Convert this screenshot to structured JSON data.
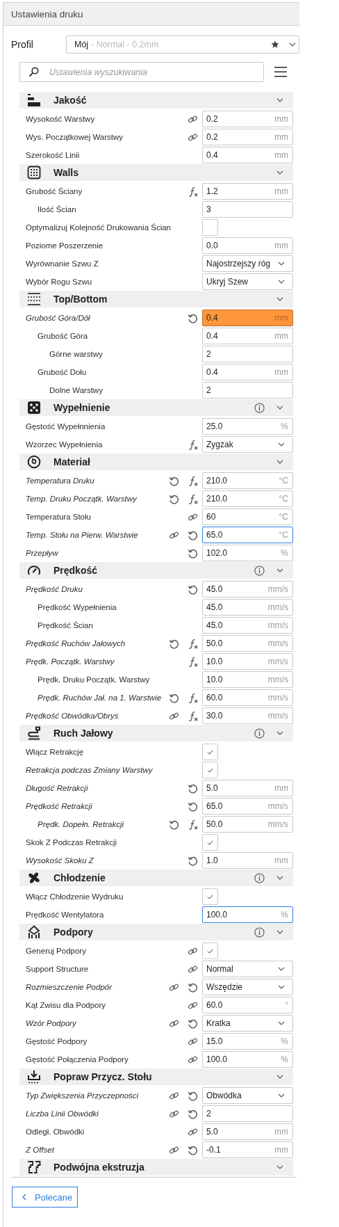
{
  "window": {
    "title": "Ustawienia druku"
  },
  "profile": {
    "label": "Profil",
    "name": "Mój",
    "detail": "- Normal - 0.2mm"
  },
  "search": {
    "placeholder": "Ustawienia wyszukiwania"
  },
  "sections": [
    {
      "kind": "quality",
      "title": "Jakość",
      "info": false,
      "rows": [
        {
          "label": "Wysokość Warstwy",
          "modified": false,
          "linked": true,
          "resettable": false,
          "formula": false,
          "kind": "number",
          "value": "0.2",
          "unit": "mm"
        },
        {
          "label": "Wys. Początkowej Warstwy",
          "modified": false,
          "linked": true,
          "resettable": false,
          "formula": false,
          "kind": "number",
          "value": "0.2",
          "unit": "mm"
        },
        {
          "label": "Szerokość Linii",
          "modified": false,
          "linked": false,
          "resettable": false,
          "formula": false,
          "kind": "number",
          "value": "0.4",
          "unit": "mm"
        }
      ]
    },
    {
      "kind": "walls",
      "title": "Walls",
      "info": false,
      "rows": [
        {
          "label": "Grubość Ściany",
          "modified": false,
          "linked": false,
          "resettable": false,
          "formula": true,
          "kind": "number",
          "value": "1.2",
          "unit": "mm",
          "children": [
            {
              "label": "Ilość Ścian",
              "modified": false,
              "linked": false,
              "resettable": false,
              "formula": false,
              "kind": "number",
              "value": "3"
            }
          ]
        },
        {
          "label": "Optymalizuj Kolejność Drukowania Ścian",
          "modified": false,
          "linked": false,
          "resettable": false,
          "formula": false,
          "kind": "checkbox",
          "checked": false
        },
        {
          "label": "Poziome Poszerzenie",
          "modified": false,
          "linked": false,
          "resettable": false,
          "formula": false,
          "kind": "number",
          "value": "0.0",
          "unit": "mm"
        },
        {
          "label": "Wyrównanie Szwu Z",
          "modified": false,
          "linked": false,
          "resettable": false,
          "formula": false,
          "kind": "dropdown",
          "value": "Najostrzejszy róg"
        },
        {
          "label": "Wybór Rogu Szwu",
          "modified": false,
          "linked": false,
          "resettable": false,
          "formula": false,
          "kind": "dropdown",
          "value": "Ukryj Szew"
        }
      ]
    },
    {
      "kind": "topbottom",
      "title": "Top/Bottom",
      "info": false,
      "rows": [
        {
          "label": "Grubość Góra/Dół",
          "modified": true,
          "linked": false,
          "resettable": true,
          "formula": false,
          "kind": "number",
          "value": "0.4",
          "unit": "mm",
          "warning": true,
          "children": [
            {
              "label": "Grubość Góra",
              "modified": false,
              "linked": false,
              "resettable": false,
              "formula": false,
              "kind": "number",
              "value": "0.4",
              "unit": "mm",
              "children": [
                {
                  "label": "Górne warstwy",
                  "modified": false,
                  "linked": false,
                  "resettable": false,
                  "formula": false,
                  "kind": "number",
                  "value": "2"
                }
              ]
            },
            {
              "label": "Grubość Dołu",
              "modified": false,
              "linked": false,
              "resettable": false,
              "formula": false,
              "kind": "number",
              "value": "0.4",
              "unit": "mm",
              "children": [
                {
                  "label": "Dolne Warstwy",
                  "modified": false,
                  "linked": false,
                  "resettable": false,
                  "formula": false,
                  "kind": "number",
                  "value": "2"
                }
              ]
            }
          ]
        }
      ]
    },
    {
      "kind": "infill",
      "title": "Wypełnienie",
      "info": true,
      "rows": [
        {
          "label": "Gęstość Wypełnnienia",
          "modified": false,
          "linked": false,
          "resettable": false,
          "formula": false,
          "kind": "number",
          "value": "25.0",
          "unit": "%"
        },
        {
          "label": "Wzorzec Wypełnienia",
          "modified": false,
          "linked": false,
          "resettable": false,
          "formula": true,
          "kind": "dropdown",
          "value": "Zygzak"
        }
      ]
    },
    {
      "kind": "material",
      "title": "Materiał",
      "info": false,
      "rows": [
        {
          "label": "Temperatura Druku",
          "modified": true,
          "linked": false,
          "resettable": true,
          "formula": true,
          "kind": "number",
          "value": "210.0",
          "unit": "°C"
        },
        {
          "label": "Temp. Druku Początk. Warstwy",
          "modified": true,
          "linked": false,
          "resettable": true,
          "formula": true,
          "kind": "number",
          "value": "210.0",
          "unit": "°C"
        },
        {
          "label": "Temperatura Stołu",
          "modified": false,
          "linked": true,
          "resettable": false,
          "formula": false,
          "kind": "number",
          "value": "60",
          "unit": "°C"
        },
        {
          "label": "Temp. Stołu na Pierw. Warstwie",
          "modified": true,
          "linked": true,
          "resettable": true,
          "formula": false,
          "kind": "number",
          "value": "65.0",
          "unit": "°C",
          "focused": true
        },
        {
          "label": "Przepływ",
          "modified": true,
          "linked": false,
          "resettable": true,
          "formula": false,
          "kind": "number",
          "value": "102.0",
          "unit": "%"
        }
      ]
    },
    {
      "kind": "speed",
      "title": "Prędkość",
      "info": true,
      "rows": [
        {
          "label": "Prędkość Druku",
          "modified": true,
          "linked": false,
          "resettable": true,
          "formula": false,
          "kind": "number",
          "value": "45.0",
          "unit": "mm/s",
          "children": [
            {
              "label": "Prędkość Wypełnienia",
              "modified": false,
              "linked": false,
              "resettable": false,
              "formula": false,
              "kind": "number",
              "value": "45.0",
              "unit": "mm/s"
            },
            {
              "label": "Prędkość Ścian",
              "modified": false,
              "linked": false,
              "resettable": false,
              "formula": false,
              "kind": "number",
              "value": "45.0",
              "unit": "mm/s"
            }
          ]
        },
        {
          "label": "Prędkość Ruchów Jałowych",
          "modified": true,
          "linked": false,
          "resettable": true,
          "formula": true,
          "kind": "number",
          "value": "50.0",
          "unit": "mm/s"
        },
        {
          "label": "Prędk. Początk. Warstwy",
          "modified": true,
          "linked": false,
          "resettable": false,
          "formula": true,
          "kind": "number",
          "value": "10.0",
          "unit": "mm/s",
          "children": [
            {
              "label": "Prędk. Druku Początk. Warstwy",
              "modified": false,
              "linked": false,
              "resettable": false,
              "formula": false,
              "kind": "number",
              "value": "10.0",
              "unit": "mm/s"
            },
            {
              "label": "Prędk. Ruchów Jał. na 1. Warstwie",
              "modified": true,
              "linked": false,
              "resettable": true,
              "formula": true,
              "kind": "number",
              "value": "60.0",
              "unit": "mm/s"
            }
          ]
        },
        {
          "label": "Prędkość Obwódka/Obrys",
          "modified": true,
          "linked": true,
          "resettable": false,
          "formula": true,
          "kind": "number",
          "value": "30.0",
          "unit": "mm/s"
        }
      ]
    },
    {
      "kind": "travel",
      "title": "Ruch Jałowy",
      "info": true,
      "rows": [
        {
          "label": "Włącz Retrakcję",
          "modified": false,
          "linked": false,
          "resettable": false,
          "formula": false,
          "kind": "checkbox",
          "checked": true
        },
        {
          "label": "Retrakcja podczas Zmiany Warstwy",
          "modified": true,
          "linked": false,
          "resettable": false,
          "formula": false,
          "kind": "checkbox",
          "checked": true
        },
        {
          "label": "Długość Retrakcji",
          "modified": true,
          "linked": false,
          "resettable": true,
          "formula": false,
          "kind": "number",
          "value": "5.0",
          "unit": "mm"
        },
        {
          "label": "Prędkość Retrakcji",
          "modified": true,
          "linked": false,
          "resettable": true,
          "formula": false,
          "kind": "number",
          "value": "65.0",
          "unit": "mm/s",
          "children": [
            {
              "label": "Prędk. Dopełn. Retrakcji",
              "modified": true,
              "linked": false,
              "resettable": true,
              "formula": true,
              "kind": "number",
              "value": "50.0",
              "unit": "mm/s"
            }
          ]
        },
        {
          "label": "Skok Z Podczas Retrakcji",
          "modified": false,
          "linked": false,
          "resettable": false,
          "formula": false,
          "kind": "checkbox",
          "checked": true
        },
        {
          "label": "Wysokość Skoku Z",
          "modified": true,
          "linked": false,
          "resettable": true,
          "formula": false,
          "kind": "number",
          "value": "1.0",
          "unit": "mm"
        }
      ]
    },
    {
      "kind": "cooling",
      "title": "Chłodzenie",
      "info": true,
      "rows": [
        {
          "label": "Włącz Chłodzenie Wydruku",
          "modified": false,
          "linked": false,
          "resettable": false,
          "formula": false,
          "kind": "checkbox",
          "checked": true
        },
        {
          "label": "Prędkość Wentylatora",
          "modified": false,
          "linked": false,
          "resettable": false,
          "formula": false,
          "kind": "number",
          "value": "100.0",
          "unit": "%",
          "focused": true
        }
      ]
    },
    {
      "kind": "support",
      "title": "Podpory",
      "info": true,
      "rows": [
        {
          "label": "Generuj Podpory",
          "modified": false,
          "linked": true,
          "resettable": false,
          "formula": false,
          "kind": "checkbox",
          "checked": true
        },
        {
          "label": "Support Structure",
          "modified": false,
          "linked": true,
          "resettable": false,
          "formula": false,
          "kind": "dropdown",
          "value": "Normal"
        },
        {
          "label": "Rozmieszczenie Podpór",
          "modified": true,
          "linked": true,
          "resettable": true,
          "formula": false,
          "kind": "dropdown",
          "value": "Wszędzie"
        },
        {
          "label": "Kąt Zwisu dla Podpory",
          "modified": false,
          "linked": true,
          "resettable": false,
          "formula": false,
          "kind": "number",
          "value": "60.0",
          "unit": "°"
        },
        {
          "label": "Wzór Podpory",
          "modified": true,
          "linked": true,
          "resettable": true,
          "formula": false,
          "kind": "dropdown",
          "value": "Kratka"
        },
        {
          "label": "Gęstość Podpory",
          "modified": false,
          "linked": true,
          "resettable": false,
          "formula": false,
          "kind": "number",
          "value": "15.0",
          "unit": "%"
        },
        {
          "label": "Gęstość Połączenia Podpory",
          "modified": false,
          "linked": true,
          "resettable": false,
          "formula": false,
          "kind": "number",
          "value": "100.0",
          "unit": "%"
        }
      ]
    },
    {
      "kind": "adhesion",
      "title": "Popraw Przycz. Stołu",
      "info": false,
      "rows": [
        {
          "label": "Typ Zwiększenia Przyczepności",
          "modified": true,
          "linked": true,
          "resettable": true,
          "formula": false,
          "kind": "dropdown",
          "value": "Obwódka"
        },
        {
          "label": "Liczba Linii Obwódki",
          "modified": true,
          "linked": true,
          "resettable": true,
          "formula": false,
          "kind": "number",
          "value": "2"
        },
        {
          "label": "Odległ. Obwódki",
          "modified": false,
          "linked": true,
          "resettable": false,
          "formula": false,
          "kind": "number",
          "value": "5.0",
          "unit": "mm"
        },
        {
          "label": "Z Offset",
          "modified": true,
          "linked": true,
          "resettable": true,
          "formula": false,
          "kind": "number",
          "value": "-0.1",
          "unit": "mm"
        }
      ]
    },
    {
      "kind": "dual",
      "title": "Podwójna ekstruzja",
      "info": false
    }
  ],
  "back_button": {
    "label": "Polecane"
  }
}
